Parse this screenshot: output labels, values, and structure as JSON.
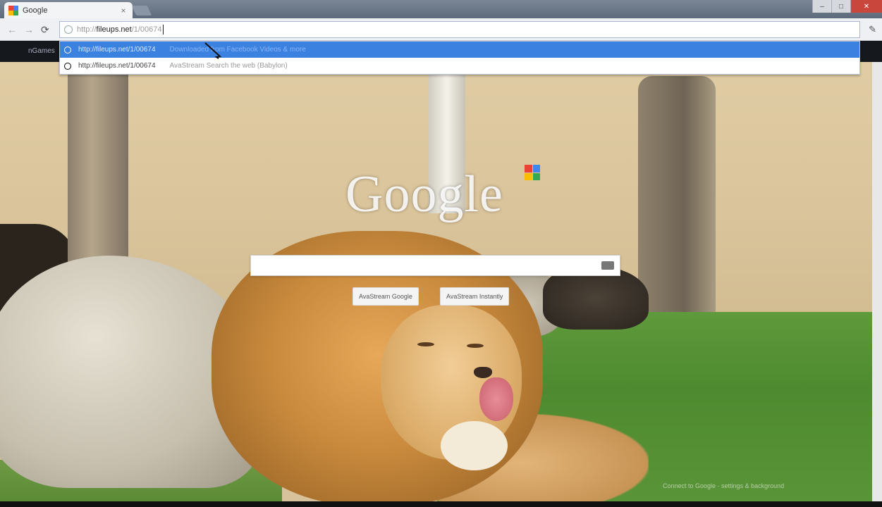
{
  "browser": {
    "tab": {
      "title": "Google"
    },
    "omnibox": {
      "scheme": "http://",
      "host": "fileups.net",
      "path": "/1/00674"
    },
    "bookmarks_text": "nGames",
    "suggestions": [
      {
        "url": "http://fileups.net/1/00674",
        "description": "Downloaded from Facebook Videos & more"
      },
      {
        "url": "http://fileups.net/1/00674",
        "description": "AvaStream Search the web (Babylon)"
      }
    ]
  },
  "page": {
    "logo_text": "Google",
    "buttons": {
      "search": "AvaStream Google",
      "lucky": "AvaStream Instantly"
    },
    "footer": "Connect to Google  ·  settings & background"
  },
  "colors": {
    "accent": "#3b82e0",
    "google_blue": "#4285f4",
    "google_red": "#ea4335",
    "google_yellow": "#fbbc05",
    "google_green": "#34a853"
  },
  "icons": {
    "favicon": "google-favicon",
    "back": "back-arrow-icon",
    "forward": "forward-arrow-icon",
    "reload": "reload-icon",
    "menu": "wrench-icon",
    "keyboard": "keyboard-icon",
    "apps": "apps-grid-icon"
  }
}
